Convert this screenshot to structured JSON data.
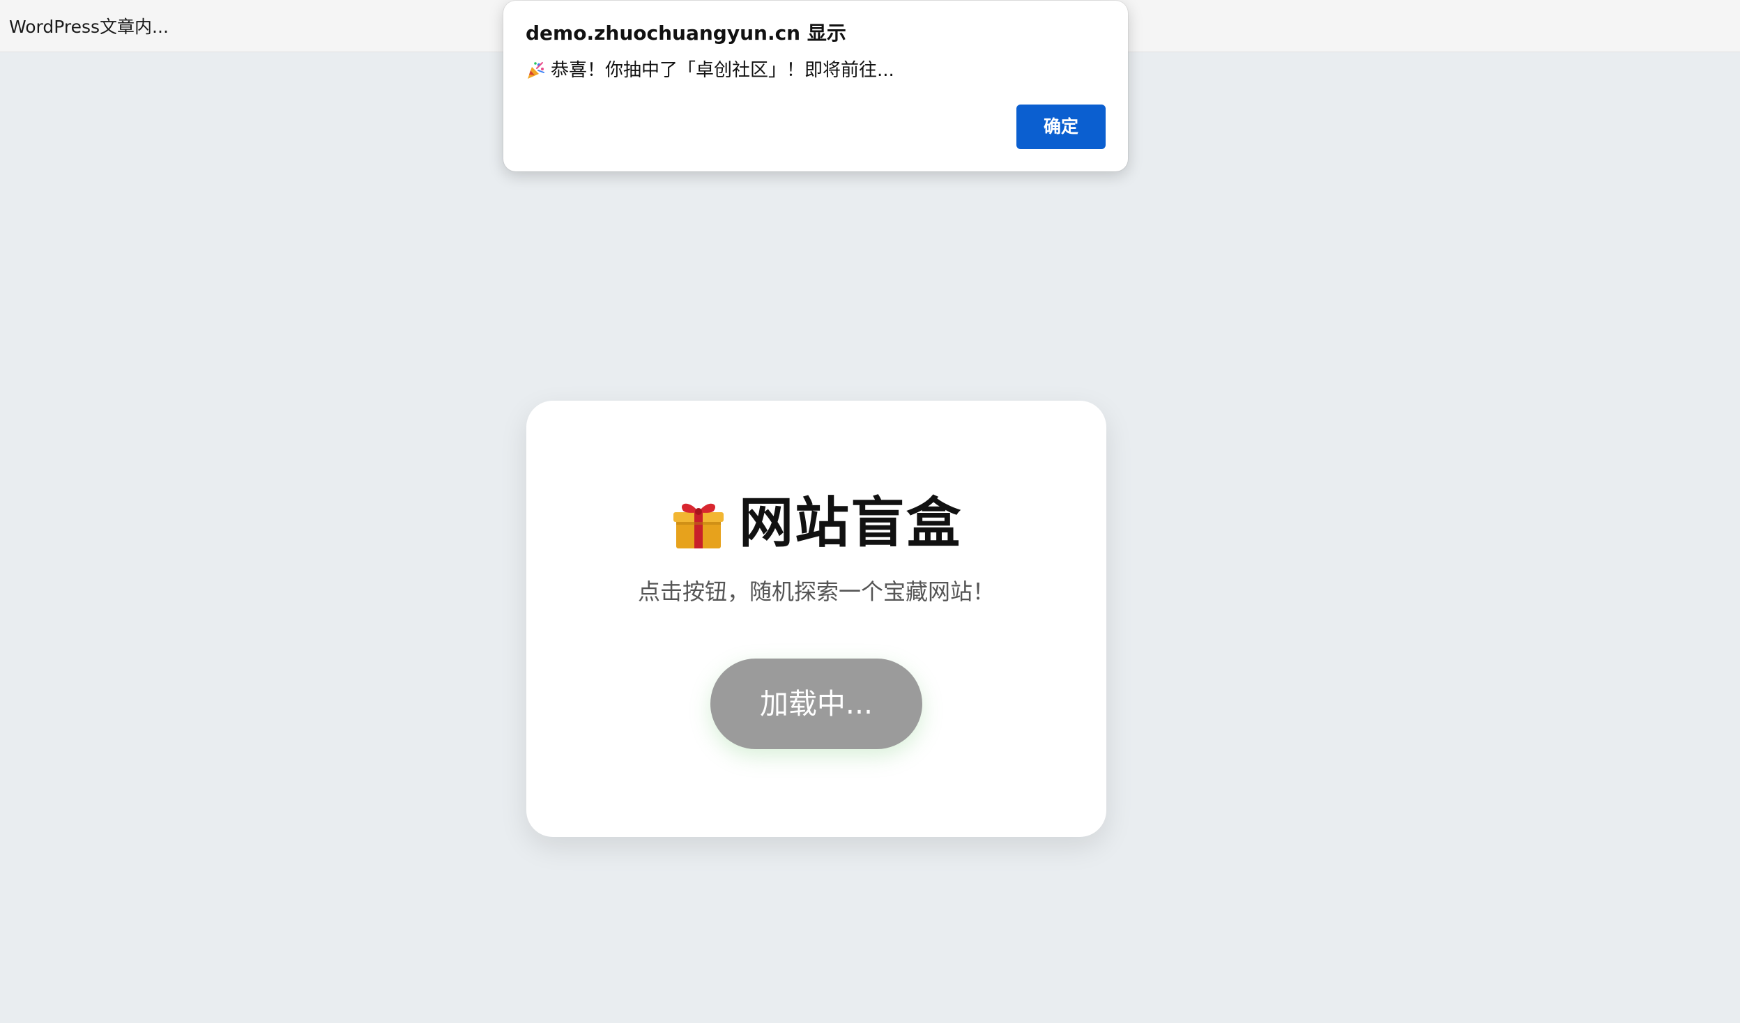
{
  "browser": {
    "tab_title": "WordPress文章内..."
  },
  "card": {
    "title": "网站盲盒",
    "title_icon": "gift-icon",
    "subtitle": "点击按钮，随机探索一个宝藏网站！",
    "button_label": "加载中..."
  },
  "dialog": {
    "title": "demo.zhuochuangyun.cn 显示",
    "message_icon": "party-popper-icon",
    "message": "恭喜！你抽中了「卓创社区」！即将前往...",
    "ok_label": "确定"
  },
  "colors": {
    "page_background": "#e9edf0",
    "card_background": "#ffffff",
    "loading_button": "#9b9b9b",
    "ok_button": "#0b5fd0"
  }
}
